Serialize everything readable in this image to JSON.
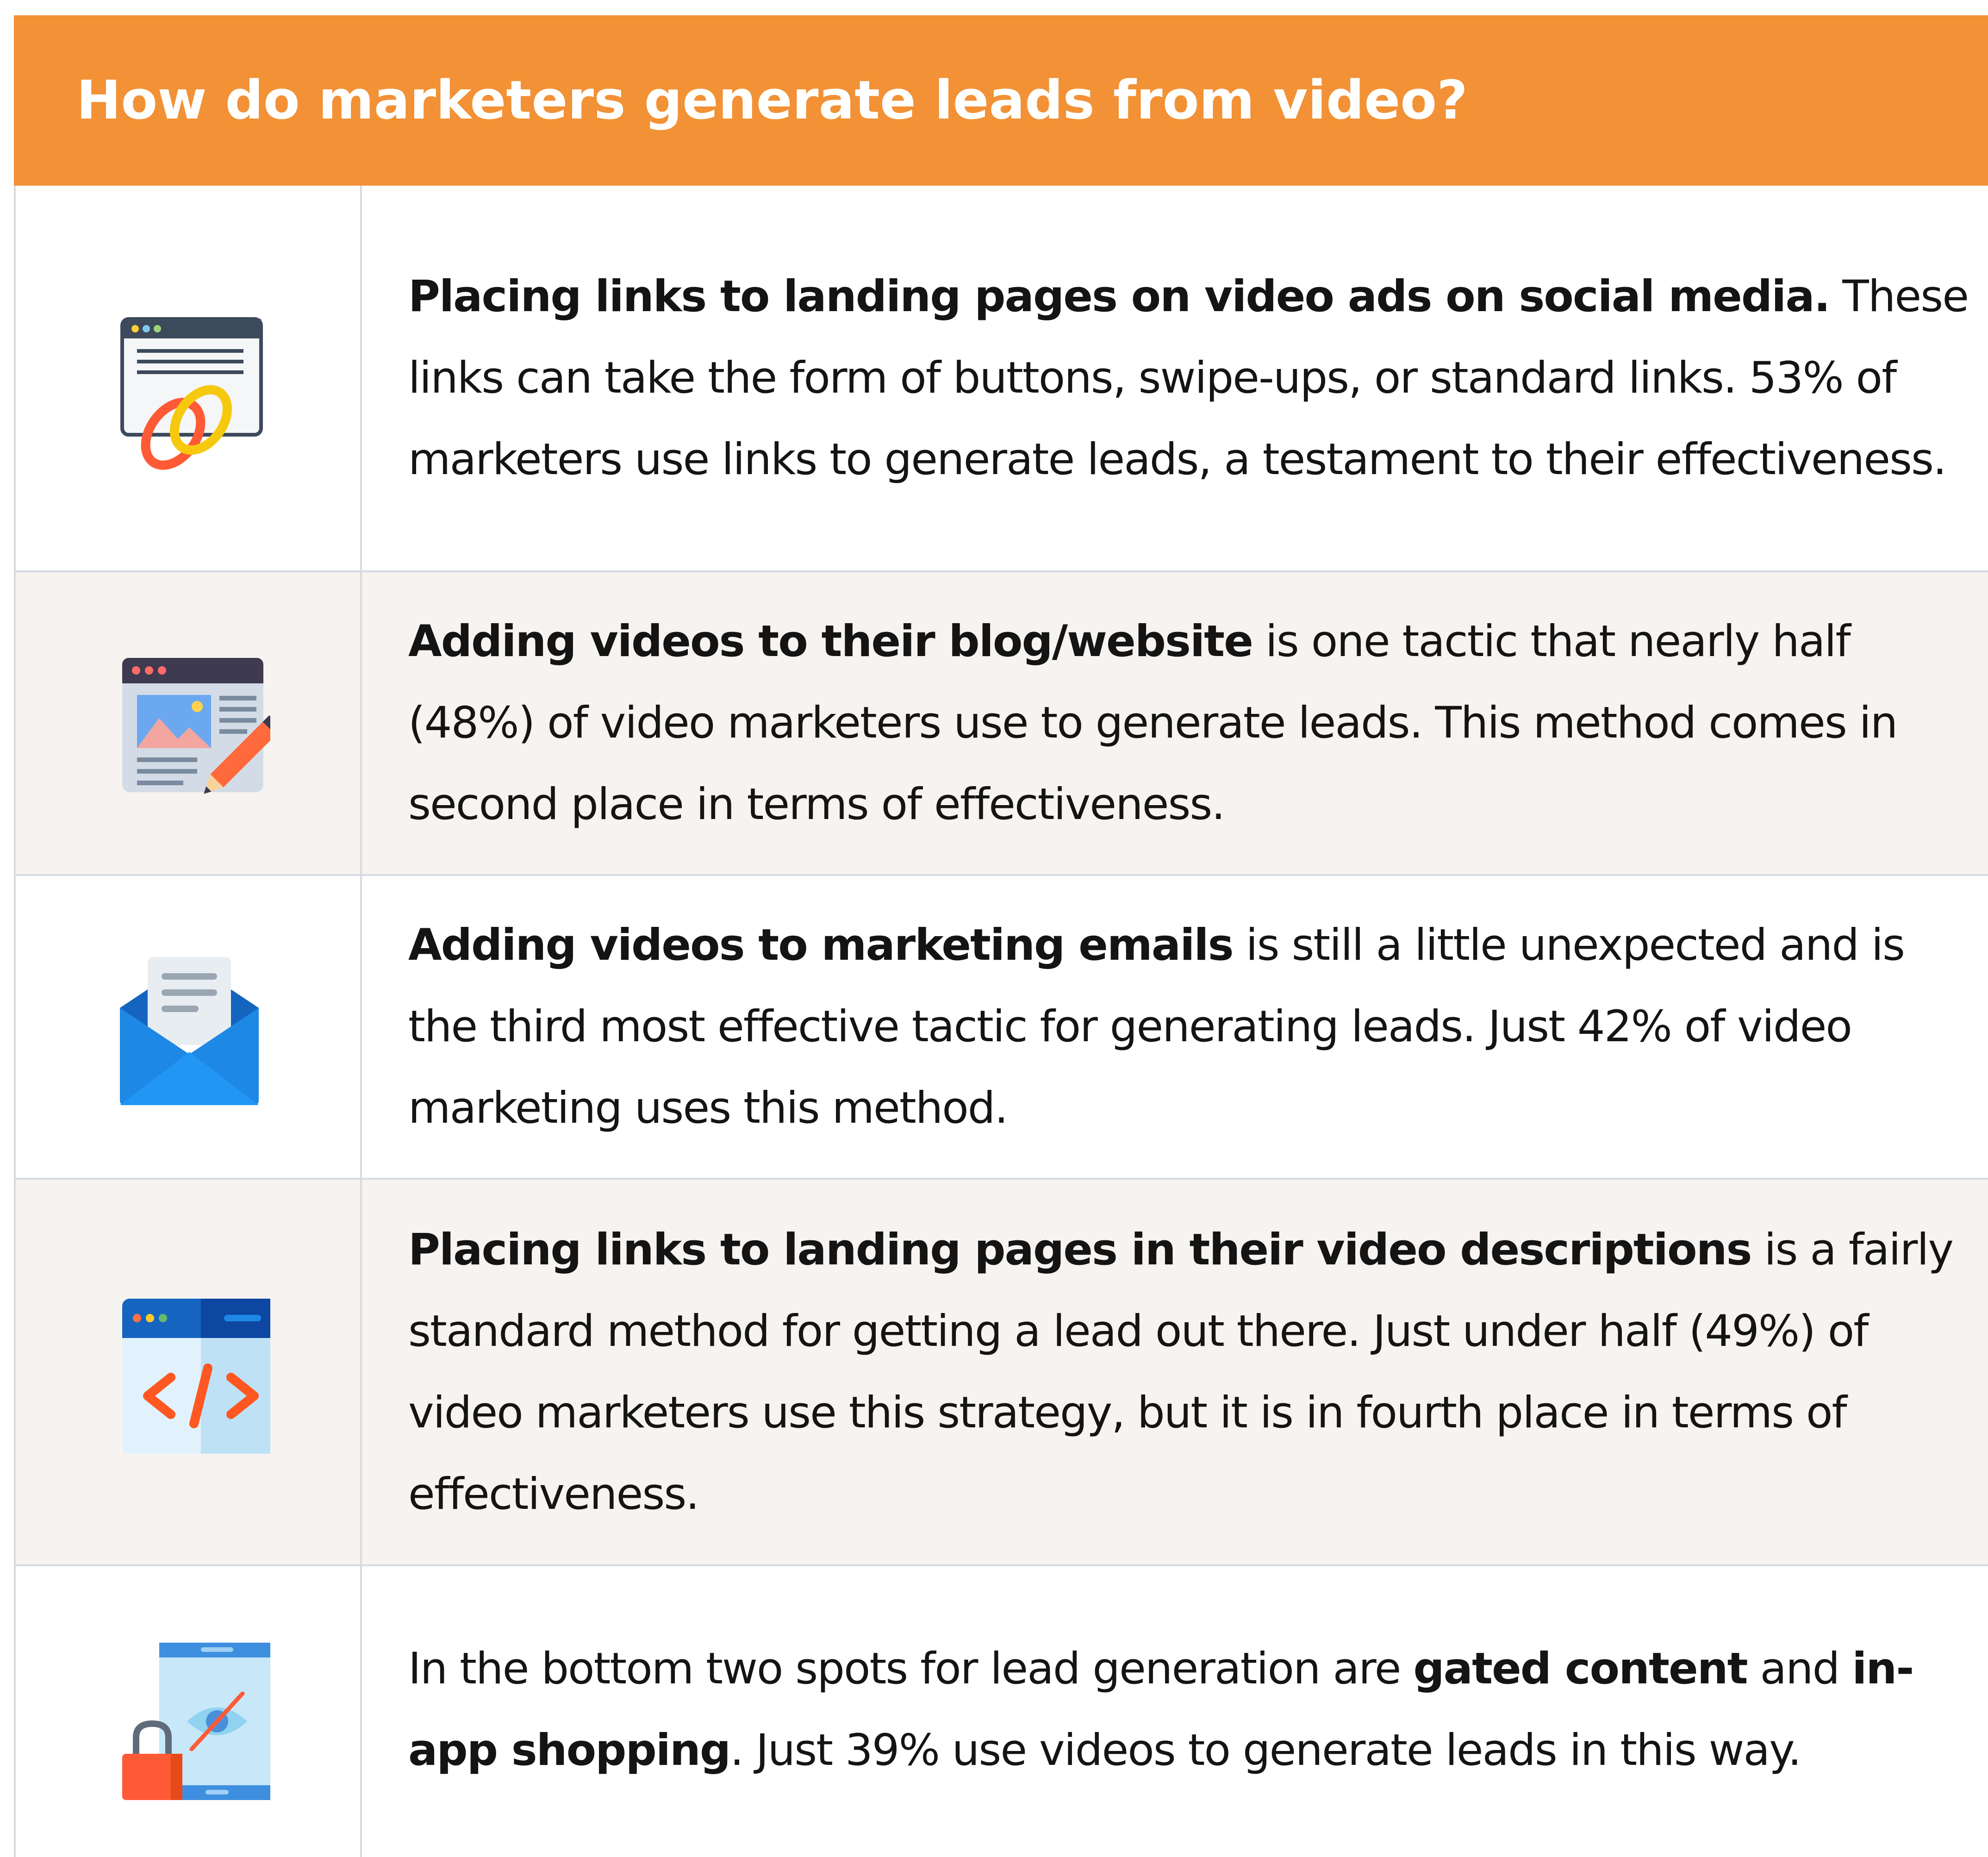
{
  "title": "How do marketers generate leads from video?",
  "colors": {
    "header_bg": "#f29135",
    "alt_row_bg": "#f6f3f0",
    "divider": "#d5dbe3"
  },
  "rows": [
    {
      "icon": "browser-link-icon",
      "bold_lead": "Placing links to landing pages on video ads on social media.",
      "text_after": " These links can take the form of buttons, swipe-ups, or standard links. 53% of marketers use links to generate leads, a testament to their effectiveness."
    },
    {
      "icon": "blog-edit-icon",
      "bold_lead": "Adding videos to their blog/website",
      "text_after": " is one tactic that nearly half (48%) of video marketers use to generate leads. This method comes in second place in terms of effectiveness."
    },
    {
      "icon": "email-envelope-icon",
      "bold_lead": "Adding videos to marketing emails",
      "text_after": " is still a little unexpected and is the third most effective tactic for generating leads. Just 42% of video marketing uses this method."
    },
    {
      "icon": "code-window-icon",
      "bold_lead": "Placing links to landing pages in their video descriptions",
      "text_after": " is a fairly standard method for getting a lead out there. Just under half (49%) of video marketers use this strategy, but it is in fourth place in terms of effectiveness."
    },
    {
      "icon": "locked-tablet-icon",
      "text_before": "In the bottom two spots for lead generation are ",
      "bold_1": "gated content",
      "text_mid": " and ",
      "bold_2": "in-app shopping",
      "text_after": ". Just 39% use videos to generate leads in this way."
    }
  ]
}
